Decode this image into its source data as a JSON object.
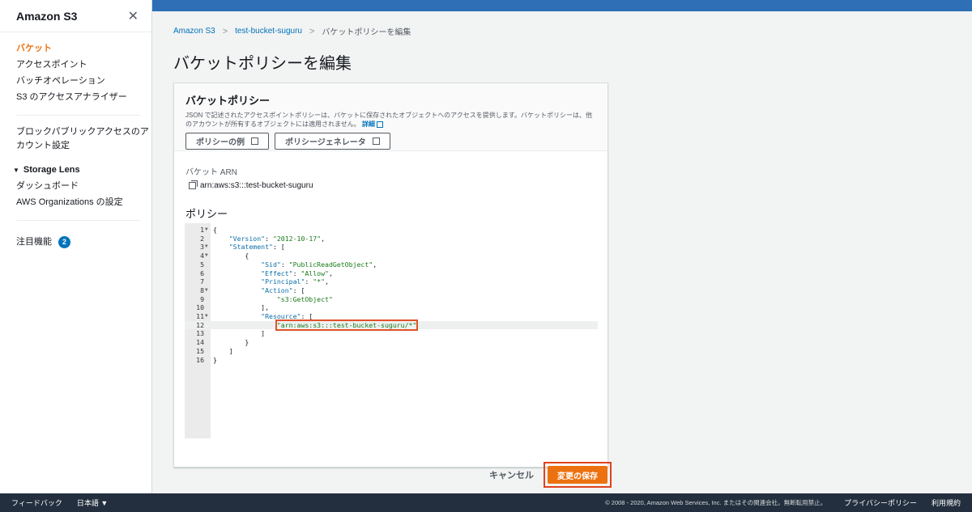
{
  "sidebar": {
    "title": "Amazon S3",
    "close_glyph": "✕",
    "items": [
      {
        "label": "バケット"
      },
      {
        "label": "アクセスポイント"
      },
      {
        "label": "バッチオペレーション"
      },
      {
        "label": "S3 のアクセスアナライザー"
      }
    ],
    "block_public_line1": "ブロックパブリックアクセスのア",
    "block_public_line2": "カウント設定",
    "storage_lens": {
      "heading": "Storage Lens",
      "items": [
        {
          "label": "ダッシュボード"
        },
        {
          "label": "AWS Organizations の設定"
        }
      ]
    },
    "featured": {
      "label": "注目機能",
      "count": "2"
    }
  },
  "breadcrumb": {
    "items": [
      "Amazon S3",
      "test-bucket-suguru",
      "バケットポリシーを編集"
    ],
    "separator": ">"
  },
  "page_title": "バケットポリシーを編集",
  "panel": {
    "title": "バケットポリシー",
    "desc_line1": "JSON で記述されたアクセスポイントポリシーは、バケットに保存されたオブジェクトへのアクセスを提供します。バケットポリシーは、他",
    "desc_line2": "のアカウントが所有するオブジェクトには適用されません。",
    "desc_link": "詳細",
    "btn_examples": "ポリシーの例",
    "btn_generator": "ポリシージェネレータ",
    "arn_label": "バケット ARN",
    "arn_value": "arn:aws:s3:::test-bucket-suguru",
    "policy_label": "ポリシー"
  },
  "editor": {
    "lines": [
      "{",
      "    \"Version\": \"2012-10-17\",",
      "    \"Statement\": [",
      "        {",
      "            \"Sid\": \"PublicReadGetObject\",",
      "            \"Effect\": \"Allow\",",
      "            \"Principal\": \"*\",",
      "            \"Action\": [",
      "                \"s3:GetObject\"",
      "            ],",
      "            \"Resource\": [",
      "                \"arn:aws:s3:::test-bucket-suguru/*\"",
      "            ]",
      "        }",
      "    ]",
      "}"
    ],
    "foldable_lines": [
      1,
      3,
      4,
      8,
      11
    ],
    "highlighted_line": 12
  },
  "actions": {
    "cancel": "キャンセル",
    "save": "変更の保存"
  },
  "footer": {
    "feedback": "フィードバック",
    "language": "日本語 ▼",
    "copyright": "© 2008 - 2020, Amazon Web Services, Inc. またはその関連会社。無断転用禁止。",
    "privacy": "プライバシーポリシー",
    "terms": "利用規約"
  },
  "colors": {
    "accent": "#ec7211",
    "link": "#0073bb",
    "topbar": "#2e6fb5",
    "footer": "#232f3e",
    "annotation": "#e0421e"
  }
}
